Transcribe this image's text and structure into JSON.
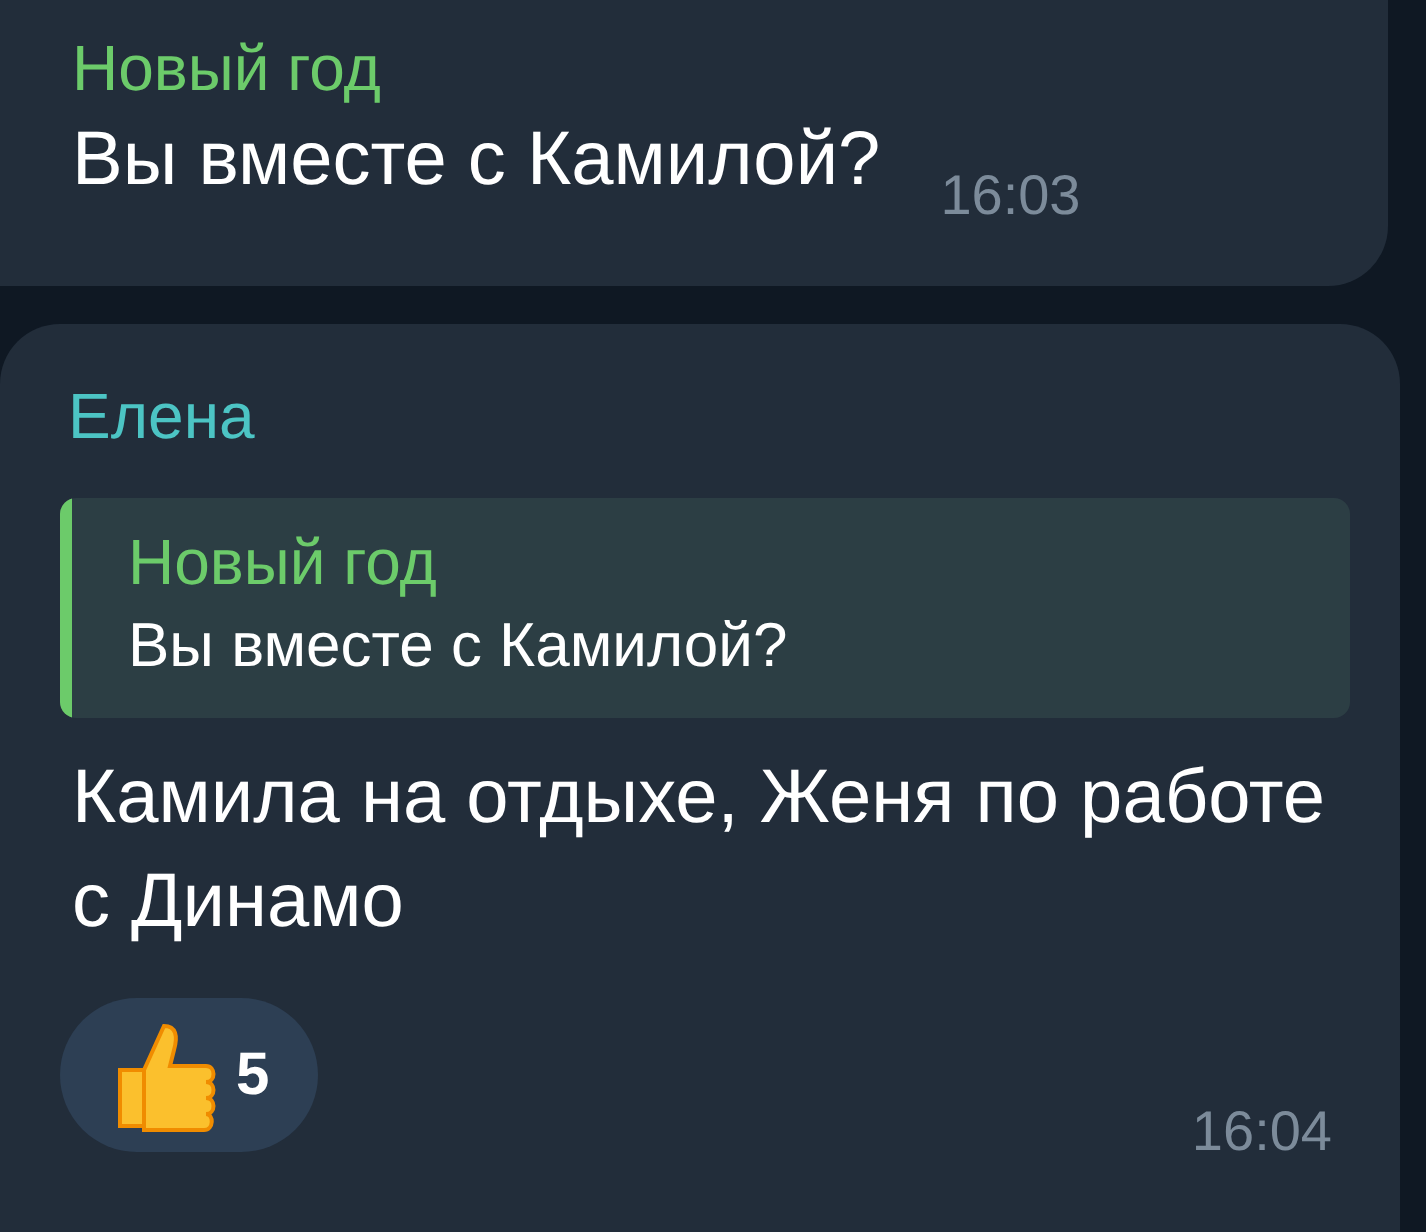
{
  "messages": [
    {
      "sender": "Новый год",
      "color": "#6ccb6a",
      "text": "Вы вместе с Камилой?",
      "time": "16:03"
    },
    {
      "sender": "Елена",
      "color": "#4cc4c4",
      "reply": {
        "sender": "Новый год",
        "text": "Вы вместе с Камилой?"
      },
      "text": "Камила на отдыхе, Женя по работе с Динамо",
      "reactions": [
        {
          "count": "5"
        }
      ],
      "time": "16:04"
    }
  ]
}
